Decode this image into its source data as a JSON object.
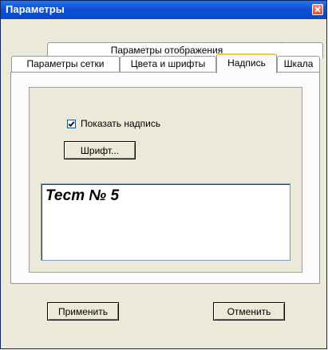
{
  "window": {
    "title": "Параметры"
  },
  "tabs": {
    "back_row": [
      "Параметры отображения"
    ],
    "front_row": [
      "Параметры сетки",
      "Цвета и шрифты",
      "Надпись",
      "Шкала"
    ],
    "active": "Надпись"
  },
  "panel": {
    "show_caption_label": "Показать надпись",
    "show_caption_checked": true,
    "font_button_label": "Шрифт...",
    "caption_text": "Тест № 5"
  },
  "buttons": {
    "apply": "Применить",
    "cancel": "Отменить"
  },
  "colors": {
    "titlebar": "#0b50d6",
    "dialog_bg": "#ece9d8",
    "active_tab_accent": "#ffc83c"
  }
}
